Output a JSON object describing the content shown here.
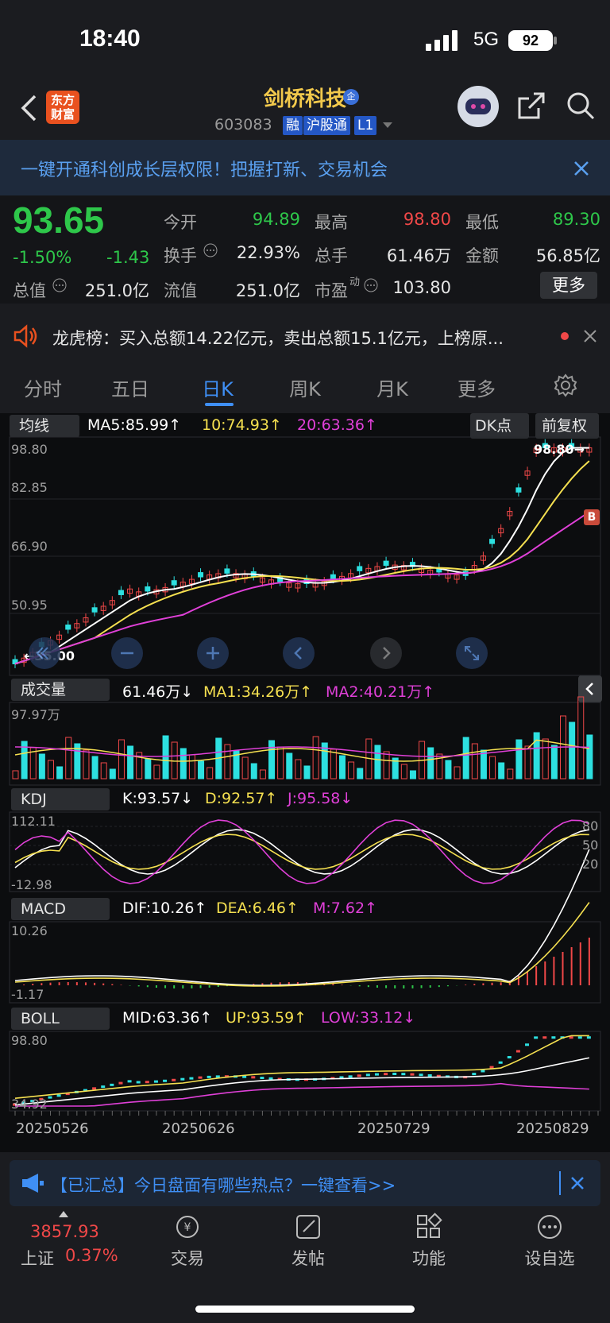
{
  "status_bar": {
    "time": "18:40",
    "network": "5G",
    "battery": "92"
  },
  "header": {
    "logo_line1": "东方",
    "logo_line2": "财富",
    "stock_name": "剑桥科技",
    "name_badge": "企",
    "stock_code": "603083",
    "tags": [
      "融",
      "沪股通",
      "L1"
    ]
  },
  "promo_banner": {
    "text": "一键开通科创成长层权限！把握打新、交易机会"
  },
  "quote": {
    "price": "93.65",
    "change_pct": "-1.50%",
    "change": "-1.43",
    "fields": [
      {
        "label": "今开",
        "value": "94.89",
        "color": "#2ec74a"
      },
      {
        "label": "最高",
        "value": "98.80",
        "color": "#f04848"
      },
      {
        "label": "最低",
        "value": "89.30",
        "color": "#2ec74a"
      },
      {
        "label": "换手",
        "value": "22.93%",
        "color": "#e6e6e6"
      },
      {
        "label": "总手",
        "value": "61.46万",
        "color": "#e6e6e6"
      },
      {
        "label": "金额",
        "value": "56.85亿",
        "color": "#e6e6e6"
      },
      {
        "label": "总值",
        "value": "251.0亿",
        "color": "#e6e6e6"
      },
      {
        "label": "流值",
        "value": "251.0亿",
        "color": "#e6e6e6"
      },
      {
        "label": "市盈",
        "value": "103.80",
        "color": "#e6e6e6"
      }
    ],
    "pe_sup": "动",
    "more_label": "更多"
  },
  "news": {
    "text": "龙虎榜：买入总额14.22亿元，卖出总额15.1亿元，上榜原..."
  },
  "tabs": [
    "分时",
    "五日",
    "日K",
    "周K",
    "月K",
    "更多"
  ],
  "active_tab": "日K",
  "main_chart": {
    "indicator_label": "均线",
    "ma5": "MA5:85.99↑",
    "ma10": "10:74.93↑",
    "ma20": "20:63.36↑",
    "dk_label": "DK点",
    "fq_label": "前复权",
    "y_labels": [
      "98.80",
      "82.85",
      "66.90",
      "50.95"
    ],
    "high_marker": "98.80→",
    "low_marker": "←35.00",
    "buy_marker": "B"
  },
  "volume_chart": {
    "label": "成交量",
    "vol": "61.46万↓",
    "ma1": "MA1:34.26万↑",
    "ma2": "MA2:40.21万↑",
    "y_max": "97.97万"
  },
  "kdj_chart": {
    "label": "KDJ",
    "k": "K:93.57↓",
    "d": "D:92.57↑",
    "j": "J:95.58↓",
    "y_max": "112.11",
    "y_min": "-12.98",
    "levels": [
      "80",
      "50",
      "20"
    ]
  },
  "macd_chart": {
    "label": "MACD",
    "dif": "DIF:10.26↑",
    "dea": "DEA:6.46↑",
    "m": "M:7.62↑",
    "y_max": "10.26",
    "y_min": "-1.17"
  },
  "boll_chart": {
    "label": "BOLL",
    "mid": "MID:63.36↑",
    "up": "UP:93.59↑",
    "low": "LOW:33.12↓",
    "y_max": "98.80",
    "y_min": "34.92"
  },
  "x_dates": [
    "20250526",
    "20250626",
    "20250729",
    "20250829"
  ],
  "bottom_banner": {
    "text": "【已汇总】今日盘面有哪些热点？一键查看>>"
  },
  "bottom_nav": {
    "index_value": "3857.93",
    "index_name": "上证",
    "index_change": "0.37%",
    "items": [
      "交易",
      "发帖",
      "功能",
      "设自选"
    ]
  },
  "colors": {
    "up": "#f04848",
    "down": "#2ec74a",
    "accent": "#3f8ff5",
    "ma5": "#ffffff",
    "ma10": "#f5e050",
    "ma20": "#e040d8",
    "cyan": "#2de0e0"
  }
}
